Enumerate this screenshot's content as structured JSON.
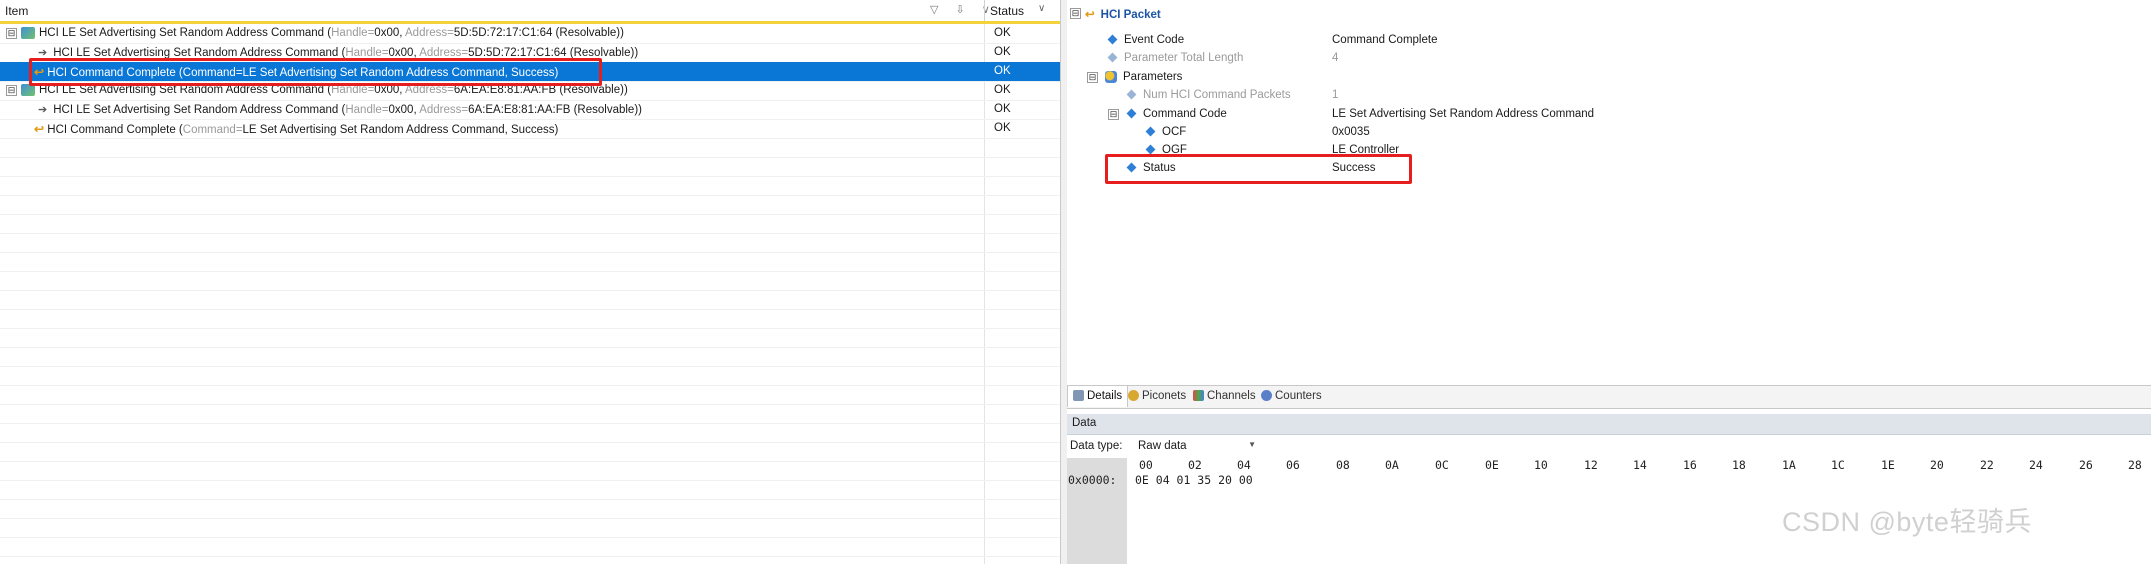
{
  "left_grid": {
    "header": {
      "item_label": "Item",
      "status_label": "Status",
      "header_icons": "▽ ⇩ ∨",
      "status_caret": "∨"
    },
    "rows": [
      {
        "title": "HCI LE Set Advertising Set Random Address Command",
        "open": " (",
        "k1": "Handle=",
        "v1": "0x00",
        "sep": ", ",
        "k2": "Address=",
        "v2": "5D:5D:72:17:C1:64 (Resolvable)",
        "close": ")",
        "status": "OK",
        "expander": "⊟"
      },
      {
        "title": "HCI LE Set Advertising Set Random Address Command",
        "open": " (",
        "k1": "Handle=",
        "v1": "0x00",
        "sep": ", ",
        "k2": "Address=",
        "v2": "5D:5D:72:17:C1:64 (Resolvable)",
        "close": ")",
        "status": "OK"
      },
      {
        "title": "HCI Command Complete",
        "open": " (",
        "k1": "Command=",
        "v1": "LE Set Advertising Set Random Address Command, Success",
        "close": ")",
        "status": "OK"
      },
      {
        "title": "HCI LE Set Advertising Set Random Address Command",
        "open": " (",
        "k1": "Handle=",
        "v1": "0x00",
        "sep": ", ",
        "k2": "Address=",
        "v2": "6A:EA:E8:81:AA:FB (Resolvable)",
        "close": ")",
        "status": "OK",
        "expander": "⊟"
      },
      {
        "title": "HCI LE Set Advertising Set Random Address Command",
        "open": " (",
        "k1": "Handle=",
        "v1": "0x00",
        "sep": ", ",
        "k2": "Address=",
        "v2": "6A:EA:E8:81:AA:FB (Resolvable)",
        "close": ")",
        "status": "OK"
      },
      {
        "title": "HCI Command Complete",
        "open": " (",
        "k1": "Command=",
        "v1": "LE Set Advertising Set Random Address Command, Success",
        "close": ")",
        "status": "OK"
      }
    ]
  },
  "details": {
    "title": "HCI Packet",
    "expander": "⊟",
    "fields": [
      {
        "key": "Event Code",
        "value": "Command Complete"
      },
      {
        "key": "Parameter Total Length",
        "value": "4"
      },
      {
        "key": "Parameters",
        "value": ""
      },
      {
        "key": "Num HCI Command Packets",
        "value": "1"
      },
      {
        "key": "Command Code",
        "value": "LE Set Advertising Set Random Address Command"
      },
      {
        "key": "OCF",
        "value": "0x0035"
      },
      {
        "key": "OGF",
        "value": "LE Controller"
      },
      {
        "key": "Status",
        "value": "Success"
      }
    ]
  },
  "tabs": [
    "Details",
    "Piconets",
    "Channels",
    "Counters"
  ],
  "data_panel": {
    "title": "Data",
    "data_type_label": "Data type:",
    "data_type_value": "Raw data",
    "hex_columns": [
      "00",
      "02",
      "04",
      "06",
      "08",
      "0A",
      "0C",
      "0E",
      "10",
      "12",
      "14",
      "16",
      "18",
      "1A",
      "1C",
      "1E",
      "20",
      "22",
      "24",
      "26",
      "28"
    ],
    "offset": "0x0000:",
    "bytes": "0E 04 01 35 20 00"
  },
  "watermark": "CSDN @byte轻骑兵",
  "colors": {
    "selection": "#0a77d6",
    "highlight": "#e61e1e",
    "header_accent": "#f3d23c",
    "packet_title": "#1c55a6"
  }
}
